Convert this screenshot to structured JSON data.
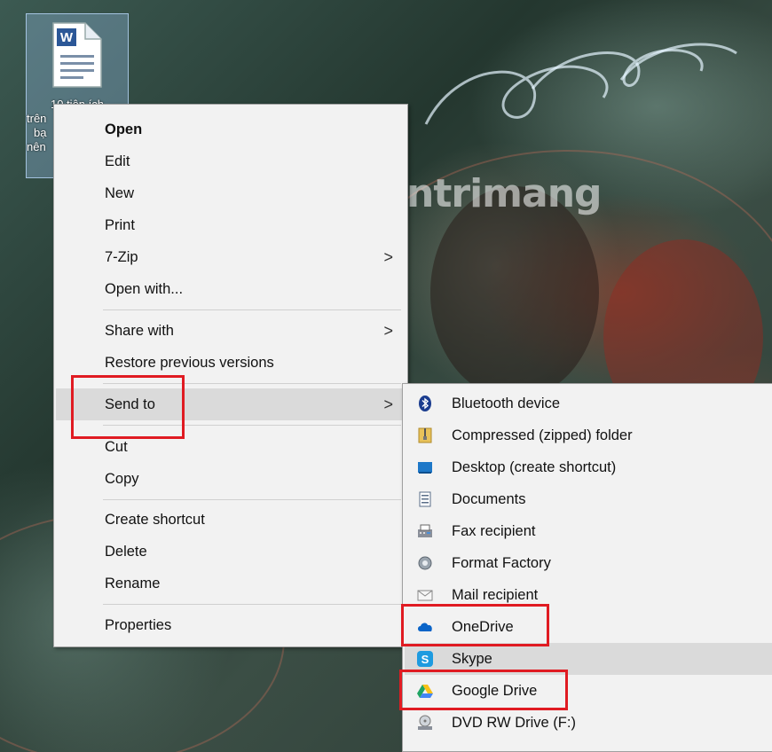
{
  "desktop": {
    "watermark": "uantrimang",
    "icon_label_lines": [
      "10 tiện ích",
      "trên",
      "bạ",
      "nên"
    ]
  },
  "context_menu": {
    "items": [
      {
        "label": "Open",
        "bold": true
      },
      {
        "label": "Edit"
      },
      {
        "label": "New"
      },
      {
        "label": "Print"
      },
      {
        "label": "7-Zip",
        "has_submenu": true
      },
      {
        "label": "Open with..."
      },
      {
        "label": "Share with",
        "has_submenu": true
      },
      {
        "label": "Restore previous versions"
      },
      {
        "label": "Send to",
        "has_submenu": true,
        "highlighted": true
      },
      {
        "label": "Cut"
      },
      {
        "label": "Copy"
      },
      {
        "label": "Create shortcut"
      },
      {
        "label": "Delete"
      },
      {
        "label": "Rename"
      },
      {
        "label": "Properties"
      }
    ],
    "submenu_arrow": ">"
  },
  "send_to_menu": {
    "items": [
      {
        "label": "Bluetooth device",
        "icon": "bluetooth-icon"
      },
      {
        "label": "Compressed (zipped) folder",
        "icon": "zip-folder-icon"
      },
      {
        "label": "Desktop (create shortcut)",
        "icon": "desktop-icon"
      },
      {
        "label": "Documents",
        "icon": "documents-icon"
      },
      {
        "label": "Fax recipient",
        "icon": "fax-icon"
      },
      {
        "label": "Format Factory",
        "icon": "format-factory-icon"
      },
      {
        "label": "Mail recipient",
        "icon": "mail-icon"
      },
      {
        "label": "OneDrive",
        "icon": "onedrive-icon"
      },
      {
        "label": "Skype",
        "icon": "skype-icon",
        "highlighted": true
      },
      {
        "label": "Google Drive",
        "icon": "google-drive-icon"
      },
      {
        "label": "DVD RW Drive (F:)",
        "icon": "dvd-drive-icon"
      }
    ]
  },
  "colors": {
    "highlight_box": "#e01b22",
    "menu_background": "#f2f2f2",
    "menu_hover": "#dadada"
  }
}
